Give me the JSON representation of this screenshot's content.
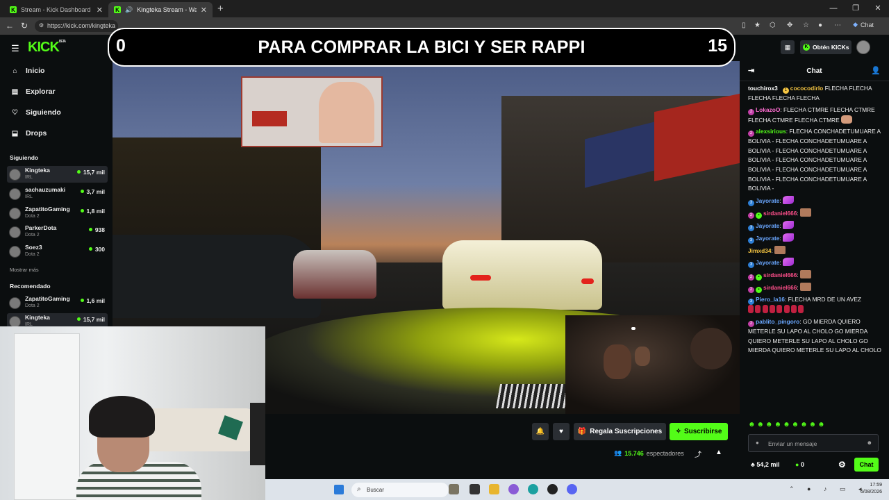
{
  "browser": {
    "tabs": [
      {
        "title": "Stream - Kick Dashboard",
        "close": "✕"
      },
      {
        "title": "Kingteka Stream - Watch Live",
        "close": "✕"
      }
    ],
    "new_tab": "+",
    "url": "https://kick.com/kingteka",
    "chat_label": "Chat"
  },
  "kick": {
    "logo": "KICK",
    "logo_sup": "BETA",
    "nav": [
      {
        "label": "Inicio",
        "icon": "⌂"
      },
      {
        "label": "Explorar",
        "icon": "▤"
      },
      {
        "label": "Siguiendo",
        "icon": "♡"
      },
      {
        "label": "Drops",
        "icon": "⬓"
      }
    ],
    "following_title": "Siguiendo",
    "following": [
      {
        "name": "Kingteka",
        "category": "IRL",
        "viewers": "15,7 mil"
      },
      {
        "name": "sachauzumaki",
        "category": "IRL",
        "viewers": "3,7 mil"
      },
      {
        "name": "ZapatitoGaming",
        "category": "Dota 2",
        "viewers": "1,8 mil"
      },
      {
        "name": "ParkerDota",
        "category": "Dota 2",
        "viewers": "938"
      },
      {
        "name": "Soez3",
        "category": "Dota 2",
        "viewers": "300"
      }
    ],
    "show_more": "Mostrar más",
    "recommended_title": "Recomendado",
    "recommended": [
      {
        "name": "ZapatitoGaming",
        "category": "Dota 2",
        "viewers": "1,6 mil"
      },
      {
        "name": "Kingteka",
        "category": "IRL",
        "viewers": "15,7 mil"
      }
    ],
    "obten_label": "Obtén KICKs"
  },
  "overlay": {
    "left_count": "0",
    "message": "PARA COMPRAR LA BICI Y SER RAPPI",
    "right_count": "15"
  },
  "stream": {
    "gift_label": "Regala Suscripciones",
    "subscribe_label": "Suscribirse",
    "viewers_count": "15.746",
    "viewers_label": "espectadores"
  },
  "chat": {
    "title": "Chat",
    "messages": [
      {
        "user": "touchirox3",
        "color": "#ffffff",
        "text": ""
      },
      {
        "user": "cococodirlo",
        "color": "#f5c542",
        "text": "FLECHA FLECHA FLECHA FLECHA FLECHA"
      },
      {
        "user": "LokazoO",
        "color": "#ff6ed2",
        "text": "FLECHA CTMRE FLECHA CTMRE FLECHA CTMRE FLECHA CTMRE"
      },
      {
        "user": "alexsirious",
        "color": "#53fc18",
        "text": "FLECHA CONCHADETUMUARE A BOLIVIA - FLECHA CONCHADETUMUARE A BOLIVIA - FLECHA CONCHADETUMUARE A BOLIVIA - FLECHA CONCHADETUMUARE A BOLIVIA - FLECHA CONCHADETUMUARE A BOLIVIA - FLECHA CONCHADETUMUARE A BOLIVIA -"
      },
      {
        "user": "Jayorate",
        "color": "#6aa7ff",
        "text": ""
      },
      {
        "user": "sirdaniel666",
        "color": "#ff4f8b",
        "text": ""
      },
      {
        "user": "Jayorate",
        "color": "#6aa7ff",
        "text": ""
      },
      {
        "user": "Jayorate",
        "color": "#6aa7ff",
        "text": ""
      },
      {
        "user": "Jimxd34",
        "color": "#f5c542",
        "text": ""
      },
      {
        "user": "Jayorate",
        "color": "#6aa7ff",
        "text": ""
      },
      {
        "user": "sirdaniel666",
        "color": "#ff4f8b",
        "text": ""
      },
      {
        "user": "sirdaniel666",
        "color": "#ff4f8b",
        "text": ""
      },
      {
        "user": "Piero_la16",
        "color": "#6aa7ff",
        "text": "FLECHA MRD DE UN AVEZ"
      },
      {
        "user": "pablito_pingoro",
        "color": "#6aa7ff",
        "text": "GO MIERDA QUIERO METERLE SU LAPO AL CHOLO GO MIERDA QUIERO METERLE SU LAPO AL CHOLO GO MIERDA QUIERO METERLE SU LAPO AL CHOLO"
      }
    ],
    "input_placeholder": "Enviar un mensaje",
    "points": "54,2 mil",
    "kicks": "0",
    "send_label": "Chat"
  },
  "taskbar": {
    "search_placeholder": "Buscar",
    "time": "17:59",
    "date": "6/08/2026"
  }
}
